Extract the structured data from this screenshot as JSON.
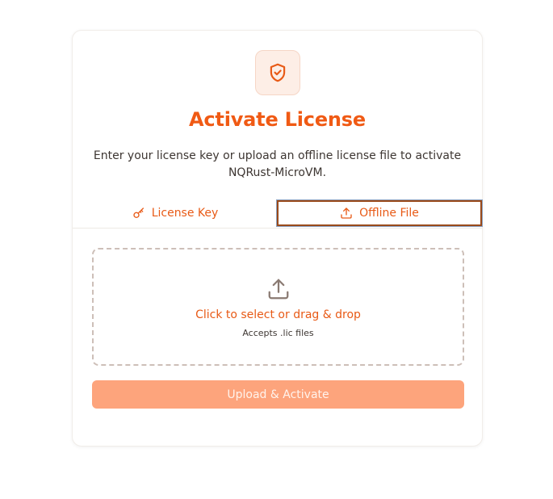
{
  "header": {
    "icon": "shield-check-icon",
    "title": "Activate License",
    "subtitle_line1": "Enter your license key or upload an offline license file to activate",
    "subtitle_line2": "NQRust-MicroVM."
  },
  "tabs": [
    {
      "label": "License Key",
      "icon": "key-icon",
      "active": false
    },
    {
      "label": "Offline File",
      "icon": "upload-icon",
      "active": true
    }
  ],
  "dropzone": {
    "icon": "upload-icon",
    "title": "Click to select or drag & drop",
    "hint": "Accepts .lic files"
  },
  "action": {
    "label": "Upload & Activate",
    "disabled": true
  },
  "colors": {
    "accent": "#f05a14",
    "icon_bg": "#fdeee6",
    "button_disabled": "#fda47c",
    "dropzone_border": "#cdbfb8"
  }
}
